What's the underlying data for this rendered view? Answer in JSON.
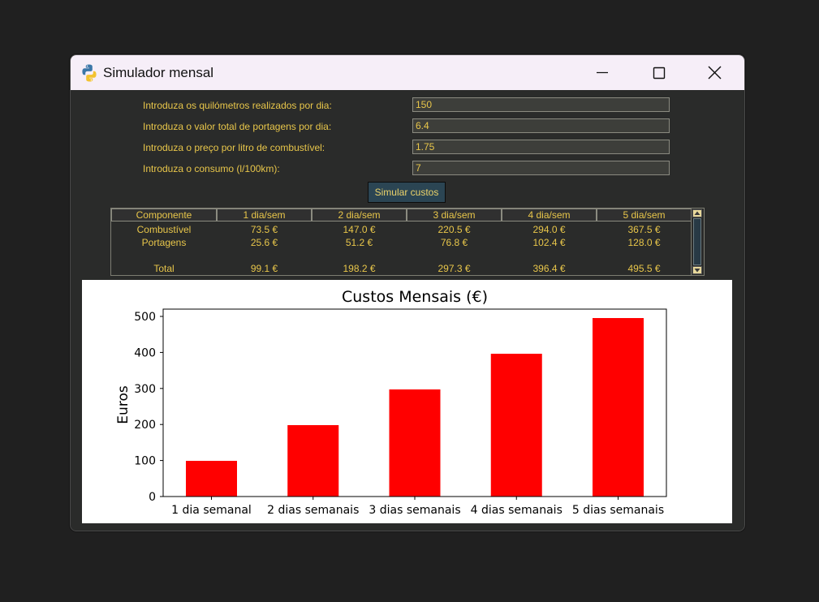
{
  "window": {
    "title": "Simulador mensal"
  },
  "form": {
    "fields": [
      {
        "label": "Introduza os quilómetros realizados por dia:",
        "value": "150"
      },
      {
        "label": "Introduza o valor total de portagens por dia:",
        "value": "6.4"
      },
      {
        "label": "Introduza o preço por litro de combustível:",
        "value": "1.75"
      },
      {
        "label": "Introduza o consumo (l/100km):",
        "value": "7"
      }
    ],
    "button_label": "Simular custos"
  },
  "table": {
    "headers": [
      "Componente",
      "1 dia/sem",
      "2 dia/sem",
      "3 dia/sem",
      "4 dia/sem",
      "5 dia/sem"
    ],
    "rows": [
      [
        "Combustível",
        "73.5 €",
        "147.0 €",
        "220.5 €",
        "294.0 €",
        "367.5 €"
      ],
      [
        "Portagens",
        "25.6 €",
        "51.2 €",
        "76.8 €",
        "102.4 €",
        "128.0 €"
      ],
      [
        "",
        "",
        "",
        "",
        "",
        ""
      ],
      [
        "Total",
        "99.1 €",
        "198.2 €",
        "297.3 €",
        "396.4 €",
        "495.5 €"
      ]
    ]
  },
  "chart_data": {
    "type": "bar",
    "title": "Custos Mensais (€)",
    "xlabel": "",
    "ylabel": "Euros",
    "categories": [
      "1 dia semanal",
      "2 dias semanais",
      "3 dias semanais",
      "4 dias semanais",
      "5 dias semanais"
    ],
    "values": [
      99.1,
      198.2,
      297.3,
      396.4,
      495.5
    ],
    "yticks": [
      0,
      100,
      200,
      300,
      400,
      500
    ],
    "ylim": [
      0,
      520.3
    ],
    "bar_color": "#ff0000",
    "grid": false
  },
  "colors": {
    "text_accent": "#e8c64a",
    "background": "#2a2b2a",
    "button_bg": "#2b4553"
  },
  "icons": [
    "python-app-icon",
    "minimize-icon",
    "maximize-icon",
    "close-icon",
    "scroll-up-icon",
    "scroll-down-icon"
  ]
}
